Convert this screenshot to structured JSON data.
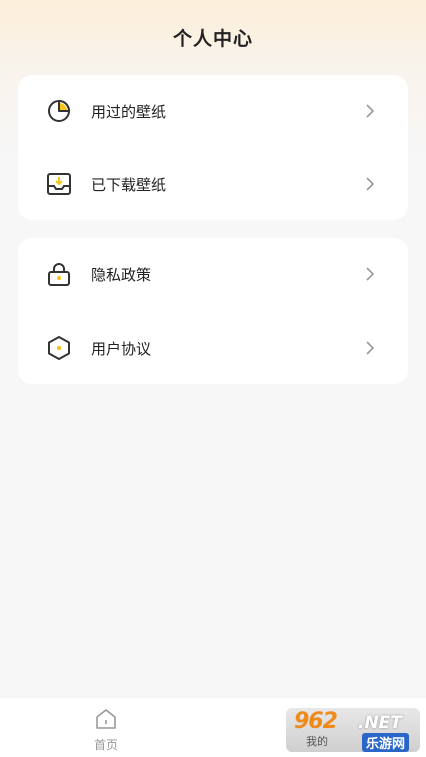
{
  "header": {
    "title": "个人中心"
  },
  "groups": [
    {
      "items": [
        {
          "label": "用过的壁纸",
          "icon": "used-wallpaper-icon"
        },
        {
          "label": "已下载壁纸",
          "icon": "downloaded-wallpaper-icon"
        }
      ]
    },
    {
      "items": [
        {
          "label": "隐私政策",
          "icon": "privacy-lock-icon"
        },
        {
          "label": "用户协议",
          "icon": "user-agreement-icon"
        }
      ]
    }
  ],
  "tabbar": {
    "home_label": "首页"
  },
  "watermark": {
    "brand": "962",
    "domain": ".NET",
    "left_text": "我的",
    "right_text": "乐游网"
  },
  "colors": {
    "accent": "#f5c518",
    "icon_stroke": "#333333",
    "chevron": "#999999"
  }
}
